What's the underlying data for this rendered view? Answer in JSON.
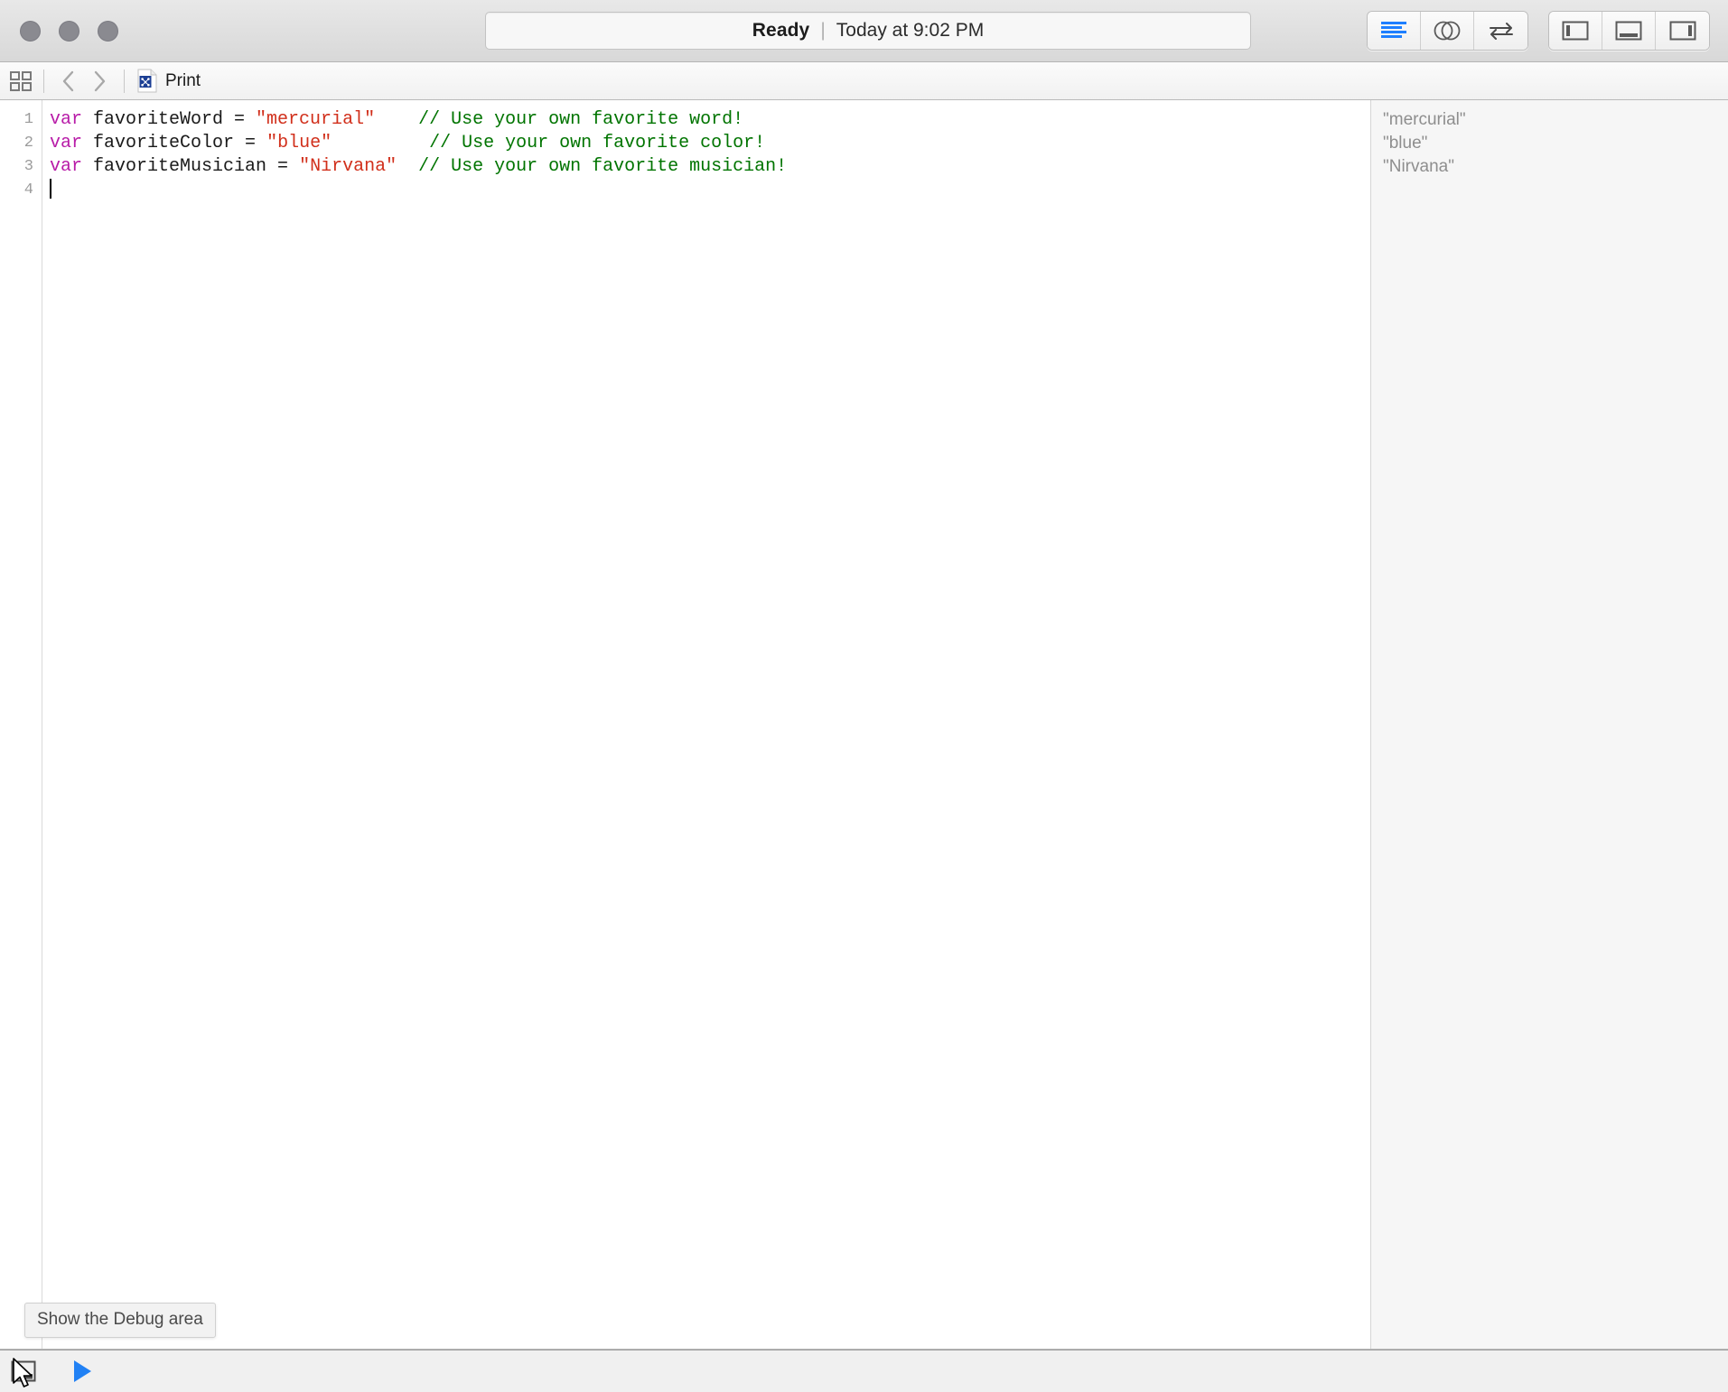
{
  "window": {
    "traffic_lights": [
      "close",
      "minimize",
      "zoom"
    ]
  },
  "toolbar": {
    "status": {
      "state": "Ready",
      "separator": "|",
      "time": "Today at 9:02 PM"
    },
    "editor_buttons": [
      {
        "name": "standard-editor",
        "icon": "lines-icon",
        "active": true
      },
      {
        "name": "assistant-editor",
        "icon": "venn-circles-icon",
        "active": false
      },
      {
        "name": "version-editor",
        "icon": "swap-arrows-icon",
        "active": false
      }
    ],
    "view_buttons": [
      {
        "name": "toggle-navigator",
        "icon": "left-panel-icon"
      },
      {
        "name": "toggle-debug-area",
        "icon": "bottom-panel-icon"
      },
      {
        "name": "toggle-utilities",
        "icon": "right-panel-icon"
      }
    ]
  },
  "jumpbar": {
    "related_items_icon": "grid-squares-icon",
    "back_icon": "chevron-left-icon",
    "forward_icon": "chevron-right-icon",
    "file_icon": "playground-file-icon",
    "file_name": "Print"
  },
  "editor": {
    "line_numbers": [
      "1",
      "2",
      "3",
      "4"
    ],
    "lines": [
      {
        "tokens": [
          {
            "type": "kw",
            "text": "var"
          },
          {
            "type": "plain",
            "text": " favoriteWord = "
          },
          {
            "type": "str",
            "text": "\"mercurial\""
          },
          {
            "type": "plain",
            "text": "    "
          },
          {
            "type": "cmt",
            "text": "// Use your own favorite word!"
          }
        ]
      },
      {
        "tokens": [
          {
            "type": "kw",
            "text": "var"
          },
          {
            "type": "plain",
            "text": " favoriteColor = "
          },
          {
            "type": "str",
            "text": "\"blue\""
          },
          {
            "type": "plain",
            "text": "         "
          },
          {
            "type": "cmt",
            "text": "// Use your own favorite color!"
          }
        ]
      },
      {
        "tokens": [
          {
            "type": "kw",
            "text": "var"
          },
          {
            "type": "plain",
            "text": " favoriteMusician = "
          },
          {
            "type": "str",
            "text": "\"Nirvana\""
          },
          {
            "type": "plain",
            "text": "  "
          },
          {
            "type": "cmt",
            "text": "// Use your own favorite musician!"
          }
        ]
      },
      {
        "tokens": [],
        "caret": true
      }
    ]
  },
  "results": {
    "values": [
      "\"mercurial\"",
      "\"blue\"",
      "\"Nirvana\"",
      ""
    ]
  },
  "tooltip": {
    "text": "Show the Debug area"
  },
  "bottombar": {
    "debug_toggle_icon": "debug-area-toggle-icon",
    "run_icon": "play-triangle-icon"
  },
  "colors": {
    "keyword": "#b81ca8",
    "string": "#d12f1b",
    "comment": "#007400",
    "plain": "#1a1a1a",
    "result_text": "#8e8e8e",
    "accent_blue": "#147efb"
  }
}
